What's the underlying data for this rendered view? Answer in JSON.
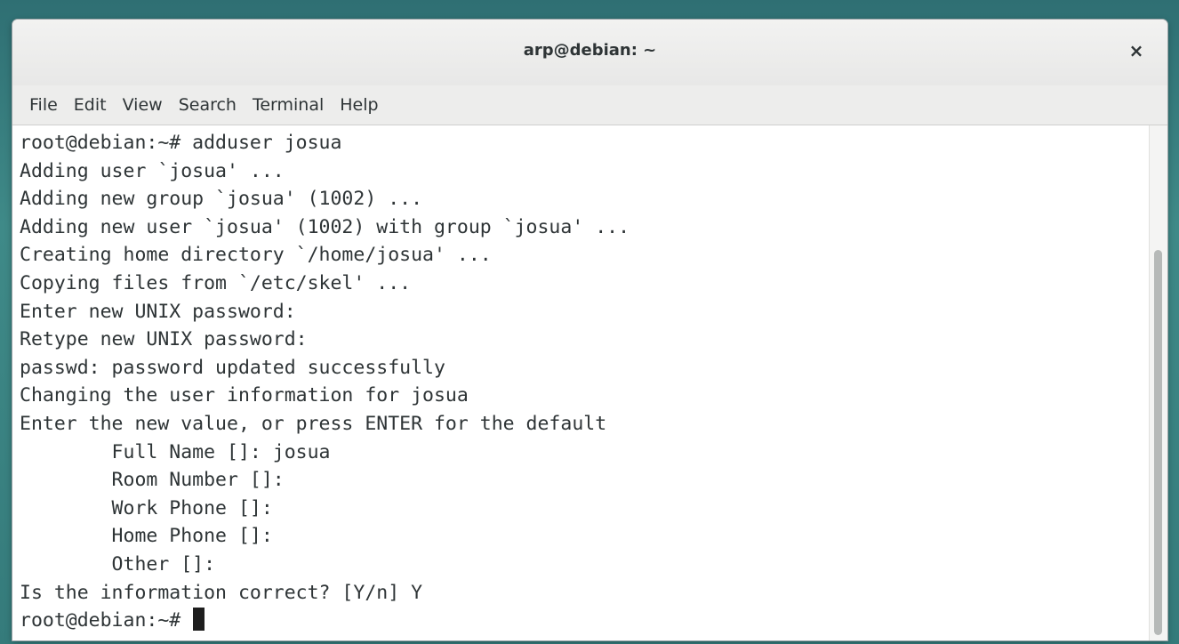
{
  "window": {
    "title": "arp@debian: ~",
    "close_glyph": "×"
  },
  "menu": [
    "File",
    "Edit",
    "View",
    "Search",
    "Terminal",
    "Help"
  ],
  "terminal": {
    "lines": [
      "root@debian:~# adduser josua",
      "Adding user `josua' ...",
      "Adding new group `josua' (1002) ...",
      "Adding new user `josua' (1002) with group `josua' ...",
      "Creating home directory `/home/josua' ...",
      "Copying files from `/etc/skel' ...",
      "Enter new UNIX password:",
      "Retype new UNIX password:",
      "passwd: password updated successfully",
      "Changing the user information for josua",
      "Enter the new value, or press ENTER for the default",
      "        Full Name []: josua",
      "        Room Number []:",
      "        Work Phone []:",
      "        Home Phone []:",
      "        Other []:",
      "Is the information correct? [Y/n] Y"
    ],
    "prompt": "root@debian:~# "
  }
}
